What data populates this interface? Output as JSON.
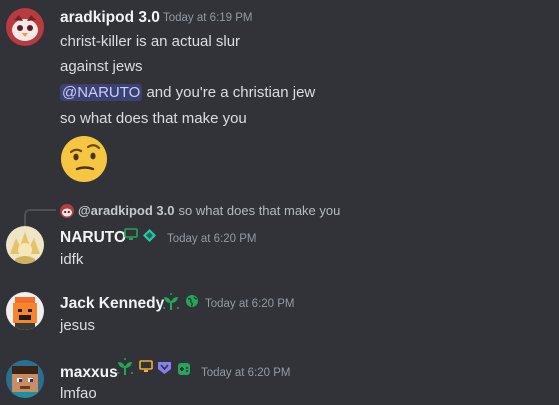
{
  "messages": [
    {
      "author": "aradkipod 3.0",
      "timestamp": "Today at 6:19 PM",
      "lines": [
        "christ-killer is an actual slur",
        "against jews"
      ],
      "mention": "@NARUTO",
      "mention_rest": " and you're a christian jew",
      "last_line": "so what does that make you",
      "emoji": "thinking-raised-eyebrow-face"
    },
    {
      "reply_author": "@aradkipod 3.0",
      "reply_text": "so what does that make you",
      "author": "NARUTO",
      "timestamp": "Today at 6:20 PM",
      "text": "idfk",
      "badges": [
        "desktop-icon",
        "nitro-gem-icon"
      ]
    },
    {
      "author": "Jack Kennedy",
      "timestamp": "Today at 6:20 PM",
      "text": "jesus",
      "badges": [
        "sprout-icon",
        "globe-icon"
      ]
    },
    {
      "author": "maxxus",
      "timestamp": "Today at 6:20 PM",
      "text": "lmfao",
      "badges": [
        "sprout-icon",
        "desktop-icon",
        "hypesquad-icon",
        "game-controller-icon"
      ]
    }
  ],
  "colors": {
    "background": "#313338",
    "username": "#f2f3f5",
    "timestamp": "#949ba4",
    "mention_bg": "#3c4270",
    "mention_text": "#c9cdfb",
    "green_badge": "#23a55a",
    "purple_badge": "#8a7ef5",
    "orange_badge": "#f0b232"
  }
}
